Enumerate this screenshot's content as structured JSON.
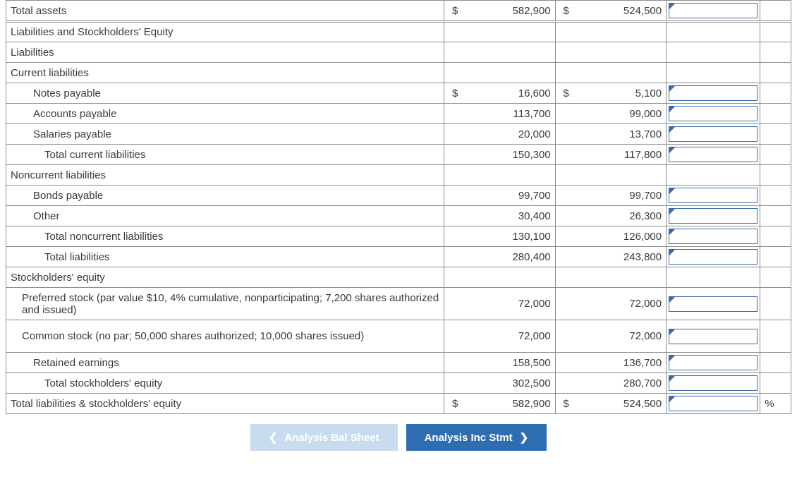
{
  "rows": [
    {
      "key": "r0",
      "label": "Total assets",
      "indent": 0,
      "cur1": "$",
      "val1": "582,900",
      "cur2": "$",
      "val2": "524,500",
      "showInput": true,
      "pct": "",
      "tall": false,
      "dblTop": false
    },
    {
      "key": "r1",
      "label": "Liabilities and Stockholders' Equity",
      "indent": 0,
      "cur1": "",
      "val1": "",
      "cur2": "",
      "val2": "",
      "showInput": false,
      "pct": "",
      "tall": false,
      "dblTop": true
    },
    {
      "key": "r2",
      "label": "Liabilities",
      "indent": 0,
      "cur1": "",
      "val1": "",
      "cur2": "",
      "val2": "",
      "showInput": false,
      "pct": "",
      "tall": false,
      "dblTop": false
    },
    {
      "key": "r3",
      "label": "Current liabilities",
      "indent": 0,
      "cur1": "",
      "val1": "",
      "cur2": "",
      "val2": "",
      "showInput": false,
      "pct": "",
      "tall": false,
      "dblTop": false
    },
    {
      "key": "r4",
      "label": "Notes payable",
      "indent": 2,
      "cur1": "$",
      "val1": "16,600",
      "cur2": "$",
      "val2": "5,100",
      "showInput": true,
      "pct": "",
      "tall": false,
      "dblTop": false
    },
    {
      "key": "r5",
      "label": "Accounts payable",
      "indent": 2,
      "cur1": "",
      "val1": "113,700",
      "cur2": "",
      "val2": "99,000",
      "showInput": true,
      "pct": "",
      "tall": false,
      "dblTop": false
    },
    {
      "key": "r6",
      "label": "Salaries payable",
      "indent": 2,
      "cur1": "",
      "val1": "20,000",
      "cur2": "",
      "val2": "13,700",
      "showInput": true,
      "pct": "",
      "tall": false,
      "dblTop": false
    },
    {
      "key": "r7",
      "label": "Total current liabilities",
      "indent": 3,
      "cur1": "",
      "val1": "150,300",
      "cur2": "",
      "val2": "117,800",
      "showInput": true,
      "pct": "",
      "tall": false,
      "dblTop": false
    },
    {
      "key": "r8",
      "label": "Noncurrent liabilities",
      "indent": 0,
      "cur1": "",
      "val1": "",
      "cur2": "",
      "val2": "",
      "showInput": false,
      "pct": "",
      "tall": false,
      "dblTop": false
    },
    {
      "key": "r9",
      "label": "Bonds payable",
      "indent": 2,
      "cur1": "",
      "val1": "99,700",
      "cur2": "",
      "val2": "99,700",
      "showInput": true,
      "pct": "",
      "tall": false,
      "dblTop": false
    },
    {
      "key": "r10",
      "label": "Other",
      "indent": 2,
      "cur1": "",
      "val1": "30,400",
      "cur2": "",
      "val2": "26,300",
      "showInput": true,
      "pct": "",
      "tall": false,
      "dblTop": false
    },
    {
      "key": "r11",
      "label": "Total noncurrent liabilities",
      "indent": 3,
      "cur1": "",
      "val1": "130,100",
      "cur2": "",
      "val2": "126,000",
      "showInput": true,
      "pct": "",
      "tall": false,
      "dblTop": false
    },
    {
      "key": "r12",
      "label": "Total liabilities",
      "indent": 3,
      "cur1": "",
      "val1": "280,400",
      "cur2": "",
      "val2": "243,800",
      "showInput": true,
      "pct": "",
      "tall": false,
      "dblTop": false
    },
    {
      "key": "r13",
      "label": "Stockholders' equity",
      "indent": 0,
      "cur1": "",
      "val1": "",
      "cur2": "",
      "val2": "",
      "showInput": false,
      "pct": "",
      "tall": false,
      "dblTop": false
    },
    {
      "key": "r14",
      "label": "Preferred stock (par value $10, 4% cumulative, nonparticipating; 7,200 shares authorized and issued)",
      "indent": 1,
      "cur1": "",
      "val1": "72,000",
      "cur2": "",
      "val2": "72,000",
      "showInput": true,
      "pct": "",
      "tall": true,
      "dblTop": false
    },
    {
      "key": "r15",
      "label": "Common stock (no par; 50,000 shares authorized; 10,000 shares issued)",
      "indent": 1,
      "cur1": "",
      "val1": "72,000",
      "cur2": "",
      "val2": "72,000",
      "showInput": true,
      "pct": "",
      "tall": true,
      "dblTop": false
    },
    {
      "key": "r16",
      "label": "Retained earnings",
      "indent": 2,
      "cur1": "",
      "val1": "158,500",
      "cur2": "",
      "val2": "136,700",
      "showInput": true,
      "pct": "",
      "tall": false,
      "dblTop": false
    },
    {
      "key": "r17",
      "label": "Total stockholders' equity",
      "indent": 3,
      "cur1": "",
      "val1": "302,500",
      "cur2": "",
      "val2": "280,700",
      "showInput": true,
      "pct": "",
      "tall": false,
      "dblTop": false
    },
    {
      "key": "r18",
      "label": "Total liabilities & stockholders' equity",
      "indent": 0,
      "cur1": "$",
      "val1": "582,900",
      "cur2": "$",
      "val2": "524,500",
      "showInput": true,
      "pct": "%",
      "tall": false,
      "dblTop": false
    }
  ],
  "nav": {
    "prev_label": "Analysis Bal Sheet",
    "next_label": "Analysis Inc Stmt"
  }
}
